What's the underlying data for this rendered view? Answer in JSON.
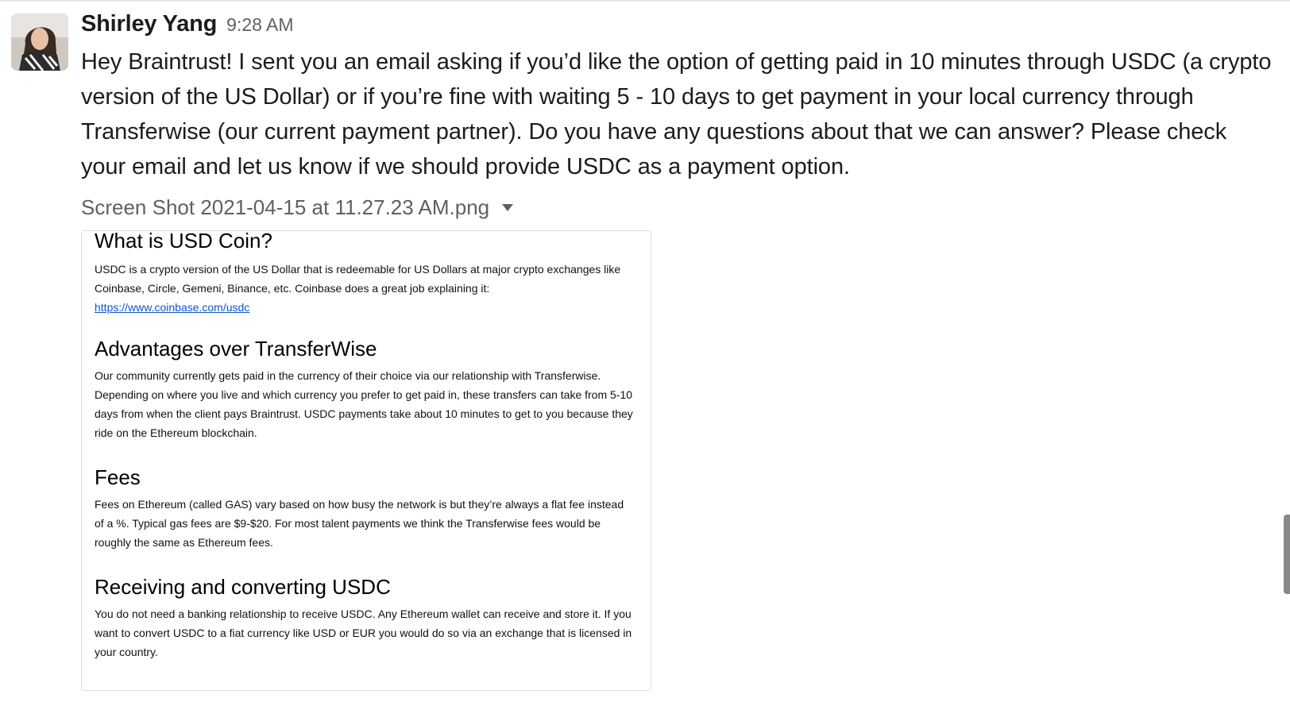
{
  "message": {
    "sender": "Shirley Yang",
    "timestamp": "9:28 AM",
    "text": "Hey Braintrust! I sent you an email asking if you’d like the option of getting paid in 10 minutes through USDC (a crypto version of the US Dollar) or if you’re fine with waiting 5 - 10 days to get payment in your local currency through Transferwise (our current payment partner). Do you have any questions about that we can answer? Please check your email and let us know if we should provide USDC as a payment option."
  },
  "attachment": {
    "filename": "Screen Shot 2021-04-15 at 11.27.23 AM.png",
    "caret_icon": "caret-down-icon",
    "document": {
      "sections": [
        {
          "heading": "What is USD Coin?",
          "body": "USDC is a crypto version of the US Dollar that is redeemable for US Dollars at major crypto exchanges like Coinbase, Circle, Gemeni, Binance, etc.  Coinbase does a great job explaining it:",
          "link": "https://www.coinbase.com/usdc"
        },
        {
          "heading": "Advantages over TransferWise",
          "body": "Our community currently gets paid in the currency of their choice via our relationship with Transferwise. Depending on where you live and which currency you prefer to get paid in, these transfers can take from 5-10 days from when the client pays Braintrust. USDC payments take about 10 minutes to get to you because they ride on the Ethereum blockchain."
        },
        {
          "heading": "Fees",
          "body": "Fees on Ethereum (called GAS) vary based on how busy the network is but they’re always a flat fee instead of a %.  Typical gas fees are $9-$20. For most talent payments we think the Transferwise fees would be roughly the same as Ethereum fees."
        },
        {
          "heading": "Receiving and converting USDC",
          "body": "You do not need a banking relationship to receive USDC. Any Ethereum wallet can receive and store it.  If you want to convert USDC to a fiat currency like USD or EUR you would do so via an exchange that is licensed in your country."
        }
      ]
    }
  },
  "colors": {
    "text_primary": "#1d1c1d",
    "text_secondary": "#616061",
    "link": "#1155cc",
    "border": "#dddddd"
  }
}
